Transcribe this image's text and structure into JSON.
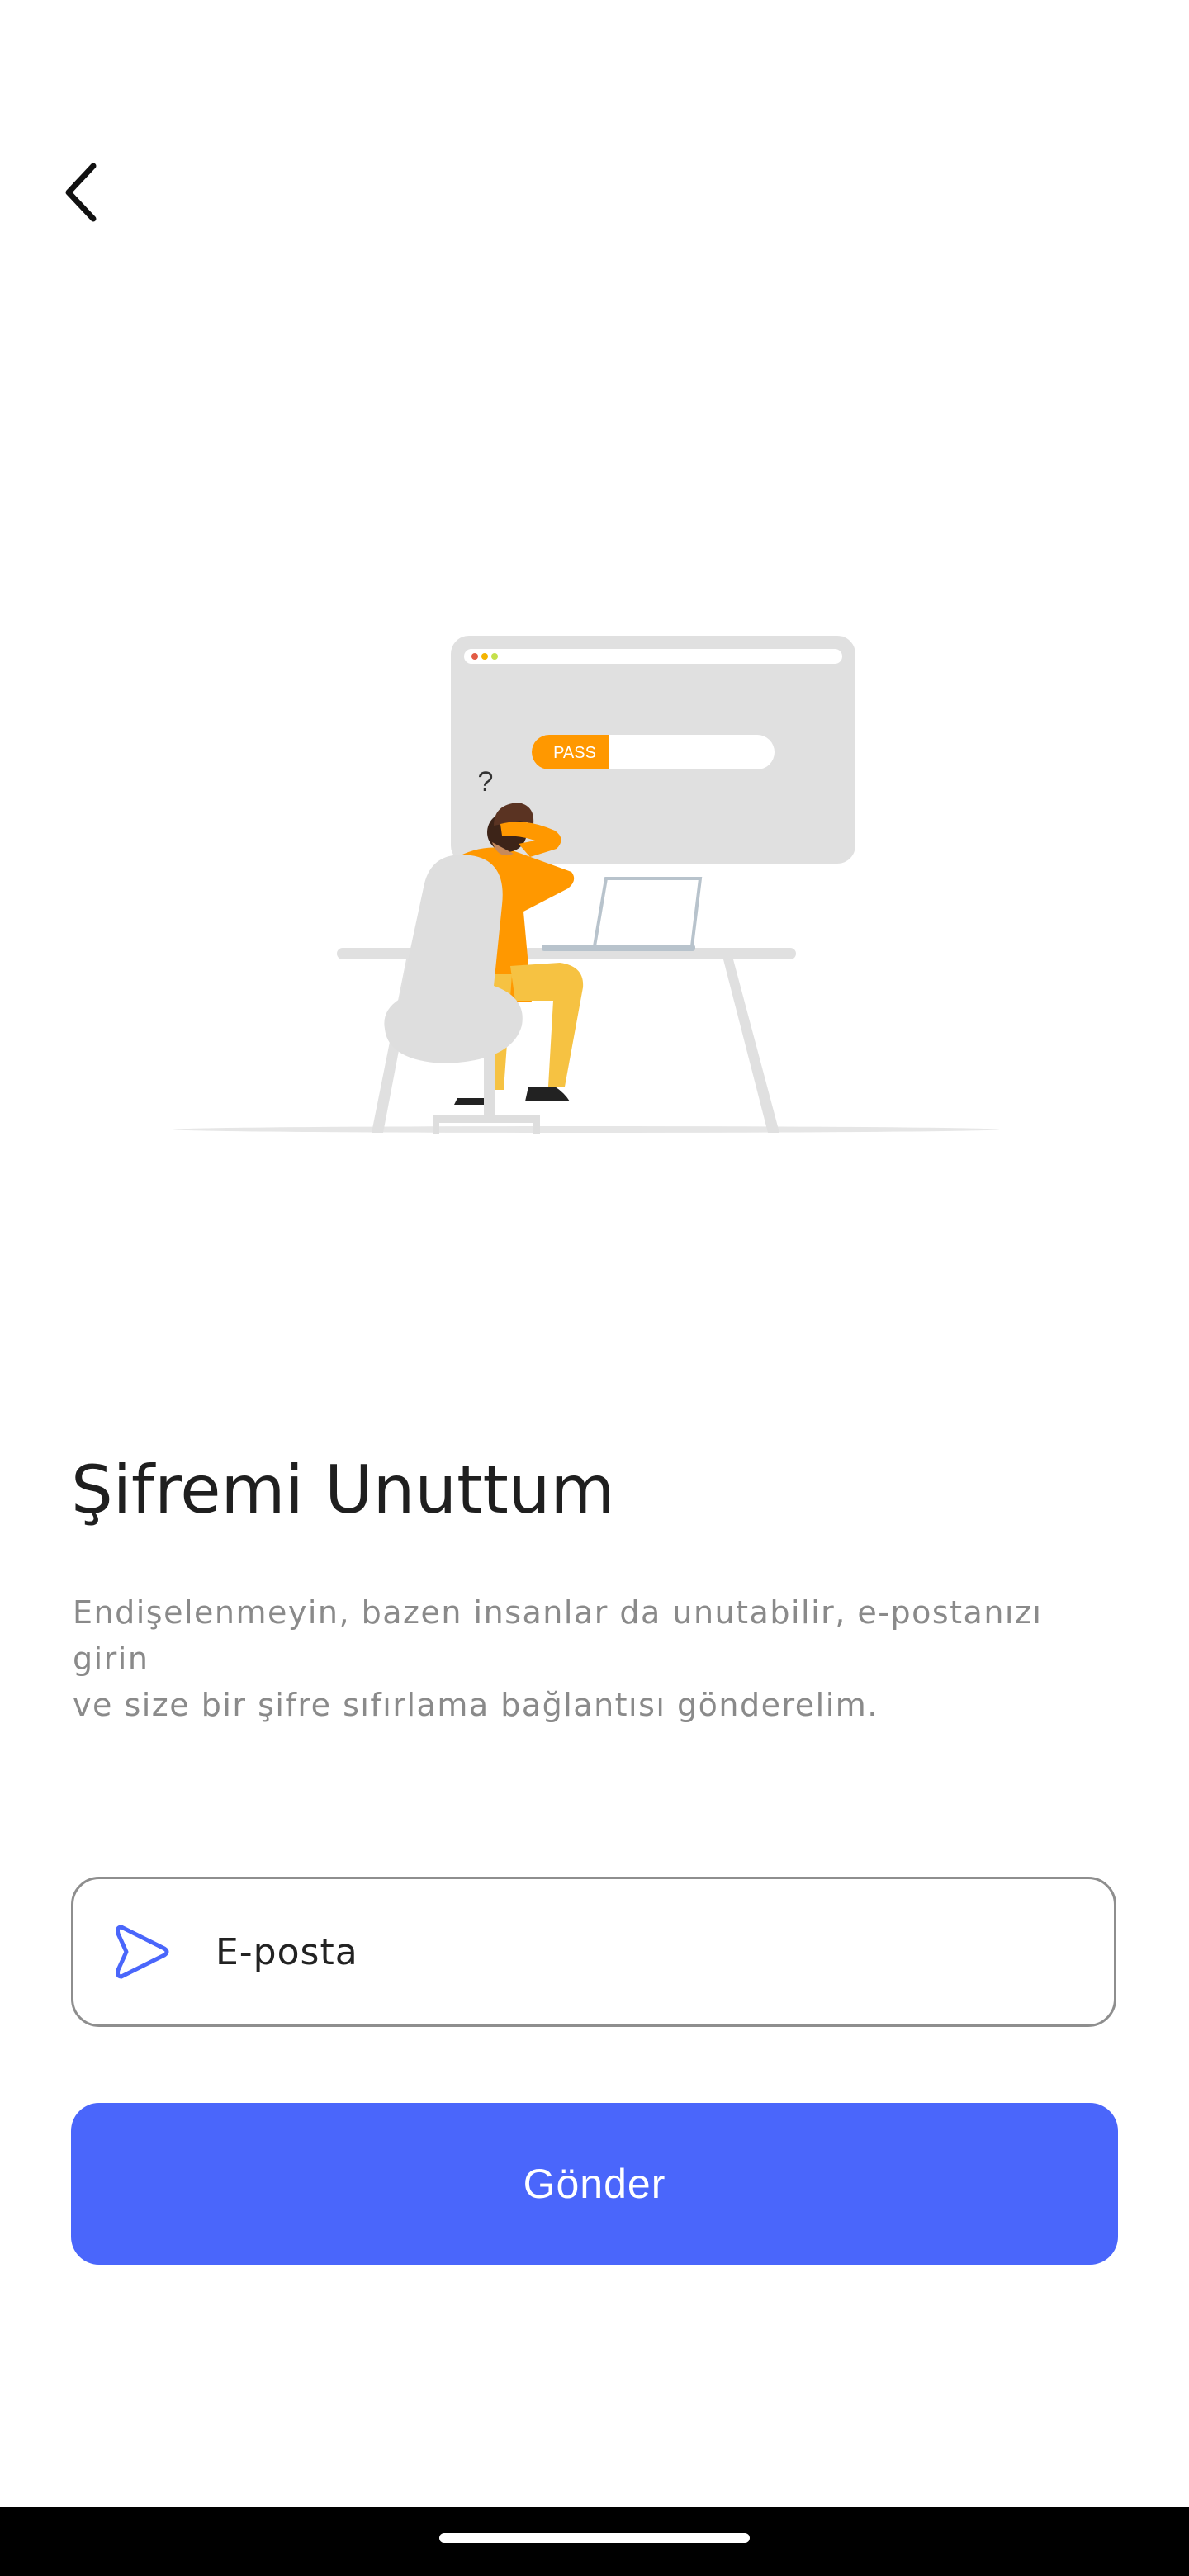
{
  "header": {
    "back_icon": "chevron-left-icon"
  },
  "illustration": {
    "password_label": "PASS",
    "question_mark": "?"
  },
  "content": {
    "title": "Şifremi Unuttum",
    "description_line1": "Endişelenmeyin, bazen insanlar da unutabilir, e-postanızı girin",
    "description_line2": "ve size bir şifre sıfırlama bağlantısı gönderelim."
  },
  "form": {
    "email_icon": "send-arrow-icon",
    "email_placeholder": "E-posta",
    "submit_label": "Gönder"
  },
  "colors": {
    "primary": "#4a66fb",
    "title": "#1f1f1f",
    "description": "#8a8a8a",
    "illustration_orange": "#ff9800",
    "illustration_gray": "#e0e0e0"
  }
}
